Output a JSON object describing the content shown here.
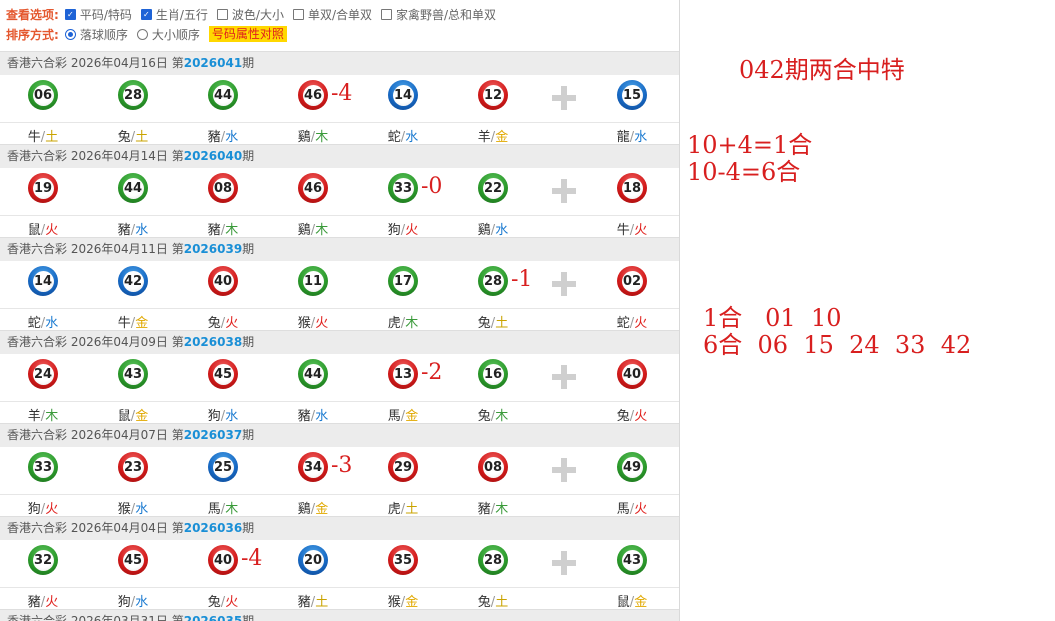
{
  "options": {
    "view_label": "查看选项:",
    "view_items": [
      {
        "label": "平码/特码",
        "checked": true
      },
      {
        "label": "生肖/五行",
        "checked": true
      },
      {
        "label": "波色/大小",
        "checked": false
      },
      {
        "label": "单双/合单双",
        "checked": false
      },
      {
        "label": "家禽野兽/总和单双",
        "checked": false
      }
    ],
    "sort_label": "排序方式:",
    "sort_items": [
      {
        "label": "落球顺序",
        "selected": true
      },
      {
        "label": "大小顺序",
        "selected": false
      }
    ],
    "compare_button": "号码属性对照"
  },
  "colors": {
    "red": "#d21a1a",
    "blue": "#1769c4",
    "green": "#2b9a2b",
    "annotation": "#d81f1f"
  },
  "draws": [
    {
      "header_prefix": "香港六合彩 2026年04月16日 第",
      "period": "2026041",
      "header_suffix": "期",
      "balls": [
        {
          "num": "06",
          "color": "green",
          "zodiac": "牛",
          "element": "土"
        },
        {
          "num": "28",
          "color": "green",
          "zodiac": "兔",
          "element": "土"
        },
        {
          "num": "44",
          "color": "green",
          "zodiac": "豬",
          "element": "水"
        },
        {
          "num": "46",
          "color": "red",
          "zodiac": "鷄",
          "element": "木"
        },
        {
          "num": "14",
          "color": "blue",
          "zodiac": "蛇",
          "element": "水"
        },
        {
          "num": "12",
          "color": "red",
          "zodiac": "羊",
          "element": "金"
        }
      ],
      "special": {
        "num": "15",
        "color": "blue",
        "zodiac": "龍",
        "element": "水"
      },
      "annotation": {
        "text": "-4",
        "after_index": 3
      }
    },
    {
      "header_prefix": "香港六合彩 2026年04月14日 第",
      "period": "2026040",
      "header_suffix": "期",
      "balls": [
        {
          "num": "19",
          "color": "red",
          "zodiac": "鼠",
          "element": "火"
        },
        {
          "num": "44",
          "color": "green",
          "zodiac": "豬",
          "element": "水"
        },
        {
          "num": "08",
          "color": "red",
          "zodiac": "豬",
          "element": "木"
        },
        {
          "num": "46",
          "color": "red",
          "zodiac": "鷄",
          "element": "木"
        },
        {
          "num": "33",
          "color": "green",
          "zodiac": "狗",
          "element": "火"
        },
        {
          "num": "22",
          "color": "green",
          "zodiac": "鷄",
          "element": "水"
        }
      ],
      "special": {
        "num": "18",
        "color": "red",
        "zodiac": "牛",
        "element": "火"
      },
      "annotation": {
        "text": "-0",
        "after_index": 4
      }
    },
    {
      "header_prefix": "香港六合彩 2026年04月11日 第",
      "period": "2026039",
      "header_suffix": "期",
      "balls": [
        {
          "num": "14",
          "color": "blue",
          "zodiac": "蛇",
          "element": "水"
        },
        {
          "num": "42",
          "color": "blue",
          "zodiac": "牛",
          "element": "金"
        },
        {
          "num": "40",
          "color": "red",
          "zodiac": "兔",
          "element": "火"
        },
        {
          "num": "11",
          "color": "green",
          "zodiac": "猴",
          "element": "火"
        },
        {
          "num": "17",
          "color": "green",
          "zodiac": "虎",
          "element": "木"
        },
        {
          "num": "28",
          "color": "green",
          "zodiac": "兔",
          "element": "土"
        }
      ],
      "special": {
        "num": "02",
        "color": "red",
        "zodiac": "蛇",
        "element": "火"
      },
      "annotation": {
        "text": "-1",
        "after_index": 5
      }
    },
    {
      "header_prefix": "香港六合彩 2026年04月09日 第",
      "period": "2026038",
      "header_suffix": "期",
      "balls": [
        {
          "num": "24",
          "color": "red",
          "zodiac": "羊",
          "element": "木"
        },
        {
          "num": "43",
          "color": "green",
          "zodiac": "鼠",
          "element": "金"
        },
        {
          "num": "45",
          "color": "red",
          "zodiac": "狗",
          "element": "水"
        },
        {
          "num": "44",
          "color": "green",
          "zodiac": "豬",
          "element": "水"
        },
        {
          "num": "13",
          "color": "red",
          "zodiac": "馬",
          "element": "金"
        },
        {
          "num": "16",
          "color": "green",
          "zodiac": "兔",
          "element": "木"
        }
      ],
      "special": {
        "num": "40",
        "color": "red",
        "zodiac": "兔",
        "element": "火"
      },
      "annotation": {
        "text": "-2",
        "after_index": 4
      }
    },
    {
      "header_prefix": "香港六合彩 2026年04月07日 第",
      "period": "2026037",
      "header_suffix": "期",
      "balls": [
        {
          "num": "33",
          "color": "green",
          "zodiac": "狗",
          "element": "火"
        },
        {
          "num": "23",
          "color": "red",
          "zodiac": "猴",
          "element": "水"
        },
        {
          "num": "25",
          "color": "blue",
          "zodiac": "馬",
          "element": "木"
        },
        {
          "num": "34",
          "color": "red",
          "zodiac": "鷄",
          "element": "金"
        },
        {
          "num": "29",
          "color": "red",
          "zodiac": "虎",
          "element": "土"
        },
        {
          "num": "08",
          "color": "red",
          "zodiac": "豬",
          "element": "木"
        }
      ],
      "special": {
        "num": "49",
        "color": "green",
        "zodiac": "馬",
        "element": "火"
      },
      "annotation": {
        "text": "-3",
        "after_index": 3
      }
    },
    {
      "header_prefix": "香港六合彩 2026年04月04日 第",
      "period": "2026036",
      "header_suffix": "期",
      "balls": [
        {
          "num": "32",
          "color": "green",
          "zodiac": "豬",
          "element": "火"
        },
        {
          "num": "45",
          "color": "red",
          "zodiac": "狗",
          "element": "水"
        },
        {
          "num": "40",
          "color": "red",
          "zodiac": "兔",
          "element": "火"
        },
        {
          "num": "20",
          "color": "blue",
          "zodiac": "豬",
          "element": "土"
        },
        {
          "num": "35",
          "color": "red",
          "zodiac": "猴",
          "element": "金"
        },
        {
          "num": "28",
          "color": "green",
          "zodiac": "兔",
          "element": "土"
        }
      ],
      "special": {
        "num": "43",
        "color": "green",
        "zodiac": "鼠",
        "element": "金"
      },
      "annotation": {
        "text": "-4",
        "after_index": 2
      }
    },
    {
      "header_prefix": "香港六合彩 2026年03月31日 第",
      "period": "2026035",
      "header_suffix": "期",
      "balls": [],
      "special": null,
      "annotation": null
    }
  ],
  "notes": {
    "title": "042期两合中特",
    "calc1": "10+4=1合",
    "calc2": "10-4=6合",
    "he1": "1合   01  10",
    "he6": "6合  06  15  24  33  42"
  }
}
